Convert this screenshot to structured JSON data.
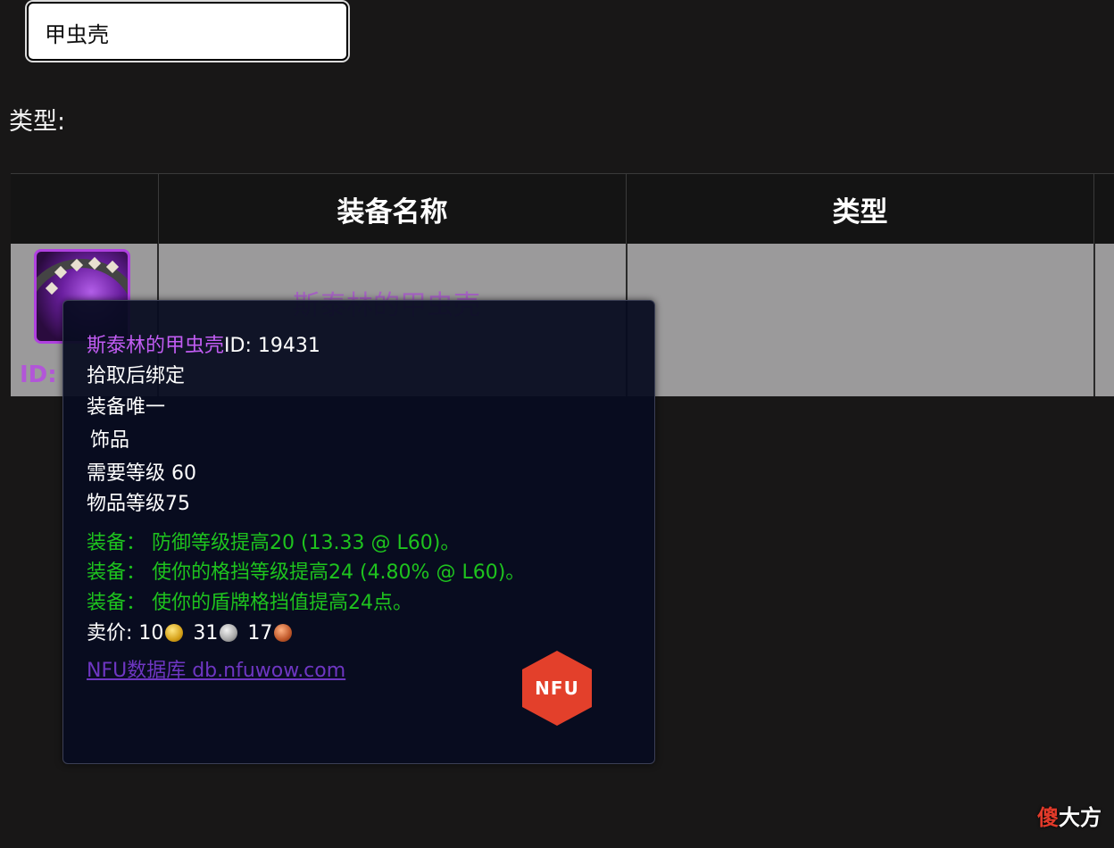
{
  "search": {
    "value": "甲虫壳"
  },
  "filter": {
    "type_label": "类型:"
  },
  "table": {
    "headers": [
      "",
      "装备名称",
      "类型",
      ""
    ],
    "row": {
      "faded_id": "ID:",
      "faded_name": "斯泰林的甲虫壳"
    }
  },
  "tooltip": {
    "item_name": "斯泰林的甲虫壳",
    "item_id": "ID: 19431",
    "bind": "拾取后绑定",
    "unique": "装备唯一",
    "slot": "饰品",
    "req_level": "需要等级 60",
    "item_level": "物品等级75",
    "effects": [
      "装备： 防御等级提高20 (13.33 @ L60)。",
      "装备： 使你的格挡等级提高24 (4.80% @ L60)。",
      "装备： 使你的盾牌格挡值提高24点。"
    ],
    "sell_label": "卖价:",
    "sell_gold": "10",
    "sell_silver": "31",
    "sell_copper": "17",
    "link_text": "NFU数据库 db.nfuwow.com",
    "logo_text": "NFU"
  },
  "watermark": {
    "first": "傻",
    "rest": "大方"
  },
  "colors": {
    "background": "#181717",
    "item_name": "#c15cf2",
    "effect_green": "#1ec31e",
    "logo_red": "#e3402b"
  }
}
